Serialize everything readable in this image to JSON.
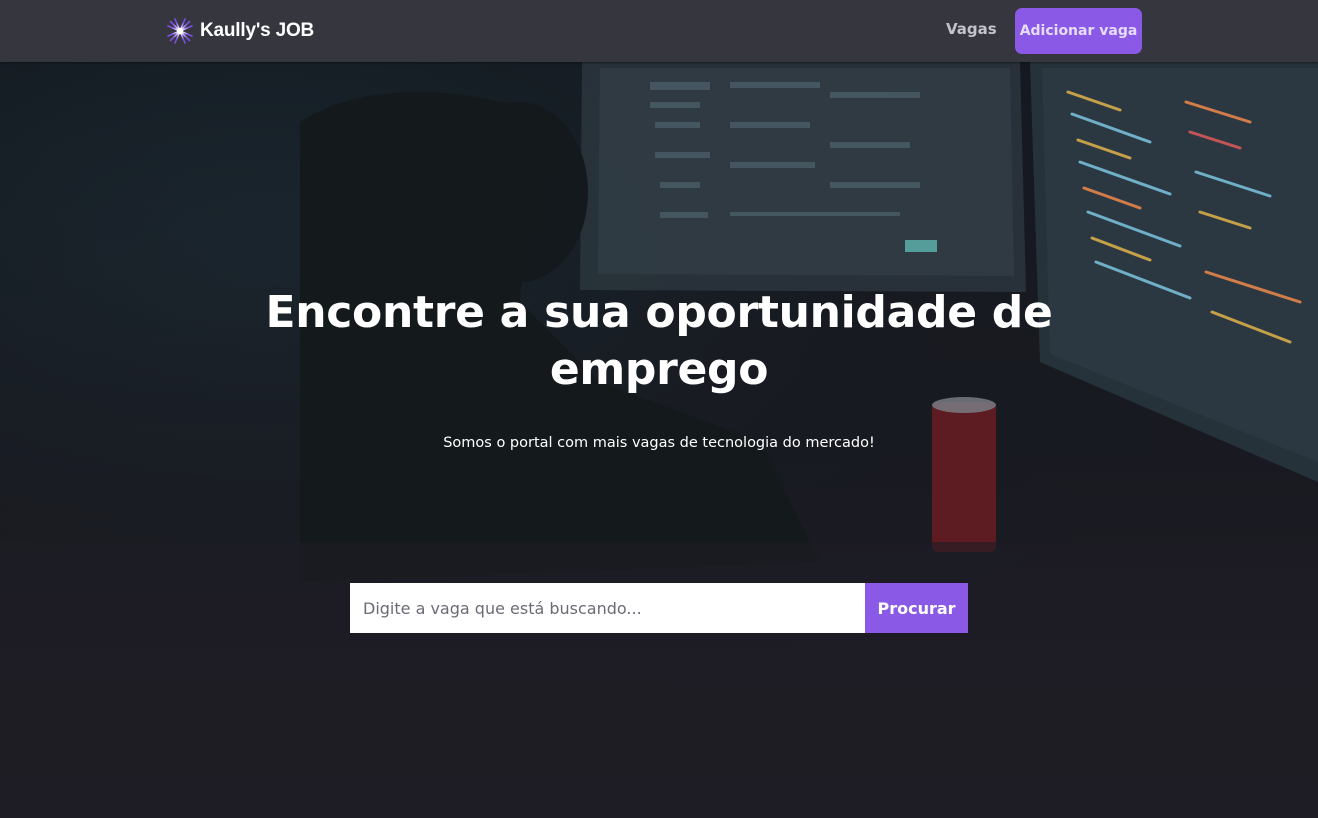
{
  "navbar": {
    "brand": {
      "icon": "starburst-logo-icon",
      "name": "Kaully's JOB"
    },
    "links": [
      {
        "label": "Vagas"
      }
    ],
    "cta": {
      "label": "Adicionar vaga"
    }
  },
  "hero": {
    "background": "developer-at-monitors-photo",
    "title": "Encontre a sua oportunidade de emprego",
    "subtitle": "Somos o portal com mais vagas de tecnologia do mercado!"
  },
  "search": {
    "value": "",
    "placeholder": "Digite a vaga que está buscando...",
    "button_label": "Procurar"
  },
  "colors": {
    "navbar_bg": "#36373e",
    "accent": "#8a5ae6",
    "page_bg": "#1e1d24"
  }
}
